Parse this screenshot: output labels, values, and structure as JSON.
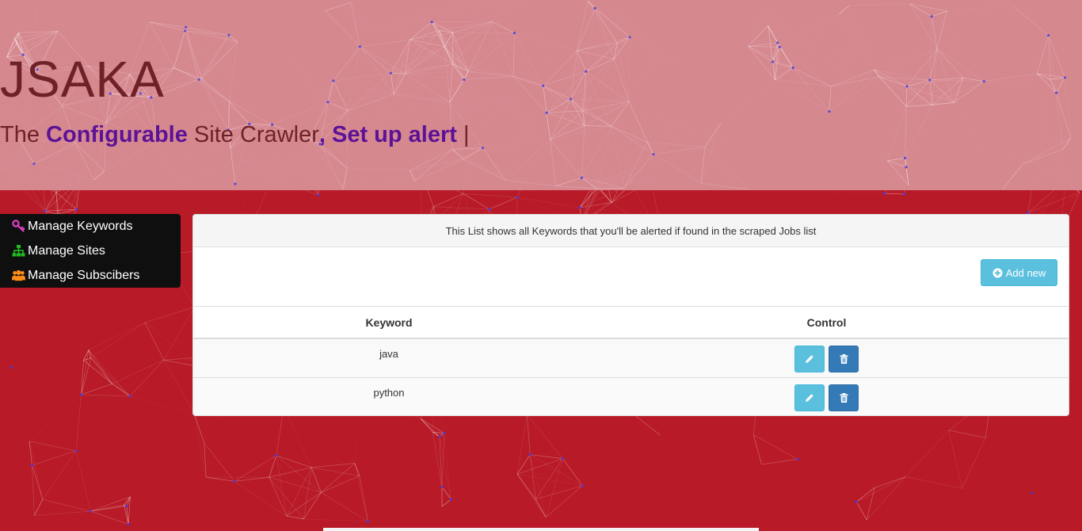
{
  "header": {
    "brand": "JSAKA",
    "tagline_prefix": "The ",
    "tagline_highlight_1": "Configurable",
    "tagline_middle": " Site Crawler",
    "tagline_highlight_2": ", Set up alert",
    "tagline_cursor": " |"
  },
  "sidebar": {
    "items": [
      {
        "label": "Manage Keywords",
        "icon": "key-icon",
        "color": "#e040c8"
      },
      {
        "label": "Manage Sites",
        "icon": "sitemap-icon",
        "color": "#22bb22"
      },
      {
        "label": "Manage Subscibers",
        "icon": "users-icon",
        "color": "#ff8c1a"
      }
    ]
  },
  "panel": {
    "heading": "This List shows all Keywords that you'll be alerted if found in the scraped Jobs list",
    "add_button": "Add new",
    "columns": [
      "Keyword",
      "Control"
    ],
    "rows": [
      {
        "keyword": "java"
      },
      {
        "keyword": "python"
      }
    ]
  },
  "colors": {
    "background": "#b81a27",
    "header_overlay": "#d78c94",
    "brand_text": "#6e2227",
    "highlight_text": "#5c1296",
    "info_button": "#5bc0de",
    "primary_button": "#337ab7"
  }
}
